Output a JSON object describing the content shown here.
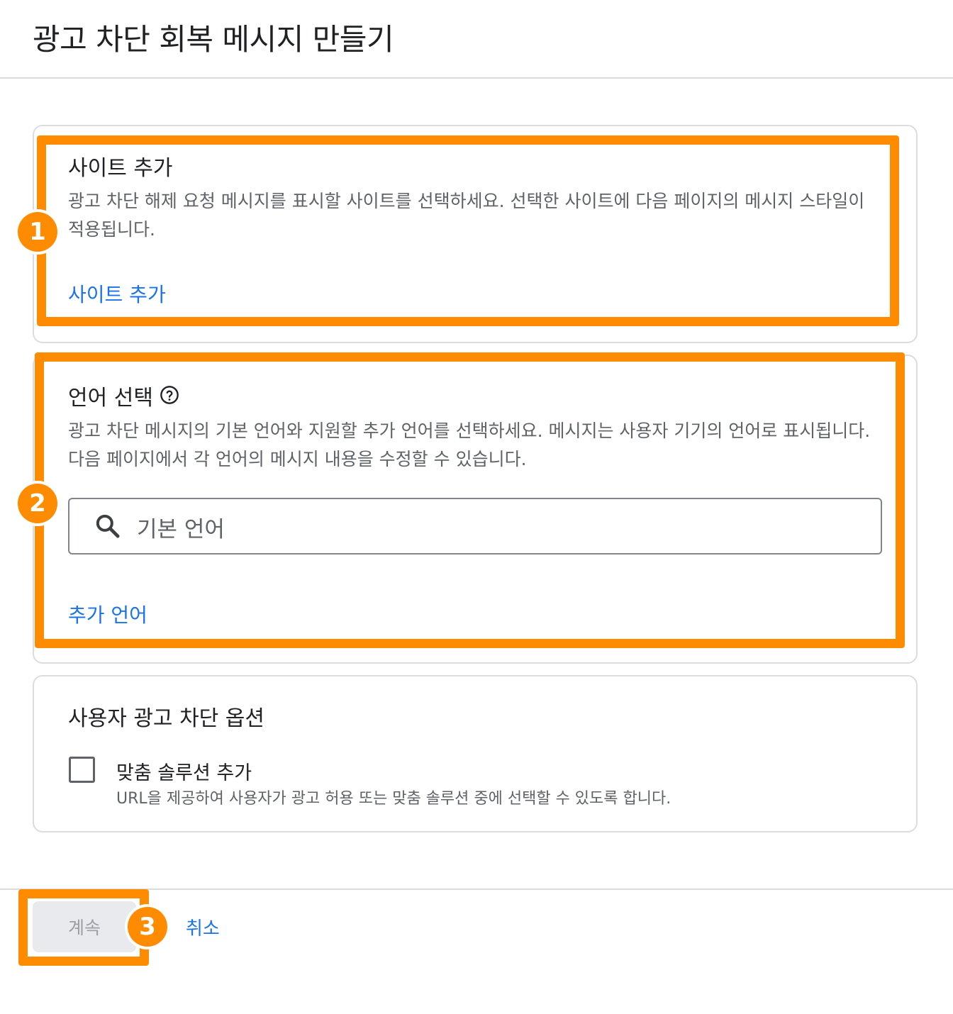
{
  "page": {
    "title": "광고 차단 회복 메시지 만들기"
  },
  "sites_section": {
    "title": "사이트 추가",
    "description": "광고 차단 해제 요청 메시지를 표시할 사이트를 선택하세요. 선택한 사이트에 다음 페이지의 메시지 스타일이 적용됩니다.",
    "add_link": "사이트 추가"
  },
  "language_section": {
    "title": "언어 선택",
    "help_icon": "help-circle-icon",
    "description": "광고 차단 메시지의 기본 언어와 지원할 추가 언어를 선택하세요. 메시지는 사용자 기기의 언어로 표시됩니다. 다음 페이지에서 각 언어의 메시지 내용을 수정할 수 있습니다.",
    "search": {
      "icon": "search-icon",
      "placeholder": "기본 언어",
      "value": ""
    },
    "add_link": "추가 언어"
  },
  "options_section": {
    "title": "사용자 광고 차단 옵션",
    "custom_solution": {
      "checked": false,
      "label": "맞춤 솔루션 추가",
      "description": "URL을 제공하여 사용자가 광고 허용 또는 맞춤 솔루션 중에 선택할 수 있도록 합니다."
    }
  },
  "footer": {
    "continue_label": "계속",
    "cancel_label": "취소"
  },
  "annotations": {
    "color": "#ff8c00",
    "badges": [
      "1",
      "2",
      "3"
    ]
  },
  "colors": {
    "link": "#1a73e8",
    "text": "#202124",
    "secondary_text": "#5f6368",
    "border": "#dadce0",
    "disabled_button_bg": "#e8eaed",
    "disabled_button_text": "#9aa0a6"
  }
}
